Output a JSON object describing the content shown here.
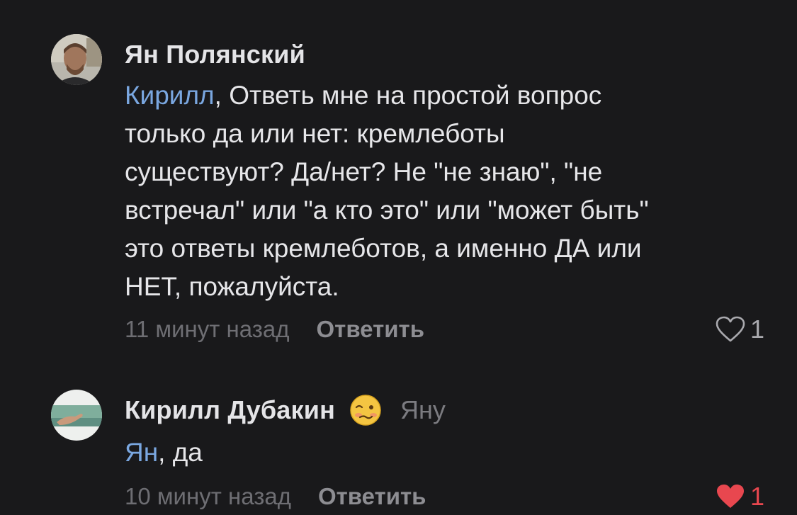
{
  "comments": [
    {
      "author": "Ян Полянский",
      "mention": "Кирилл",
      "text": ", Ответь мне на простой вопрос\nтолько да или нет: кремлеботы\nсуществуют? Да/нет?  Не \"не знаю\", \"не\nвстречал\" или \"а кто это\" или \"может быть\"\nэто ответы кремлеботов, а именно ДА или\nНЕТ, пожалуйста.",
      "time": "11 минут назад",
      "reply_label": "Ответить",
      "likes": "1",
      "liked": false
    },
    {
      "author": "Кирилл Дубакин",
      "reply_to": "Яну",
      "mention": "Ян",
      "text": ", да",
      "time": "10 минут назад",
      "reply_label": "Ответить",
      "likes": "1",
      "liked": true
    }
  ],
  "colors": {
    "background": "#19191b",
    "mention": "#7aa7e0",
    "like_active": "#e8474f",
    "like_inactive": "#a9a9ae"
  },
  "icons": {
    "like_outline": "heart-outline-icon",
    "like_filled": "heart-filled-icon",
    "badge": "woozy-face-icon"
  }
}
